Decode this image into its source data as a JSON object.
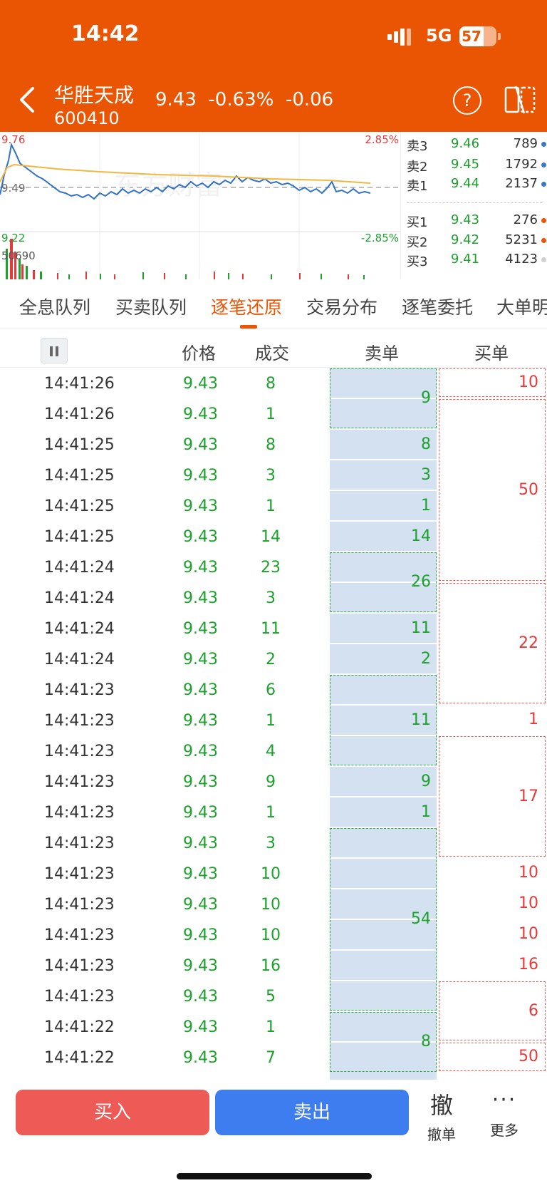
{
  "status_bar": {
    "time": "14:42",
    "network": "5G",
    "battery": "57"
  },
  "header": {
    "stock_name": "华胜天成",
    "stock_code": "600410",
    "price": "9.43",
    "change_pct": "-0.63%",
    "change": "-0.06",
    "help_label": "?"
  },
  "chart": {
    "high_price": "9.76",
    "pre_close": "9.49",
    "low_price": "9.22",
    "high_pct": "2.85%",
    "low_pct": "-2.85%",
    "volume_max": "50690",
    "watermark": "东方财富"
  },
  "orderbook": {
    "asks": [
      {
        "label": "卖3",
        "price": "9.46",
        "qty": "789"
      },
      {
        "label": "卖2",
        "price": "9.45",
        "qty": "1792"
      },
      {
        "label": "卖1",
        "price": "9.44",
        "qty": "2137"
      }
    ],
    "bids": [
      {
        "label": "买1",
        "price": "9.43",
        "qty": "276"
      },
      {
        "label": "买2",
        "price": "9.42",
        "qty": "5231"
      },
      {
        "label": "买3",
        "price": "9.41",
        "qty": "4123"
      }
    ]
  },
  "tabs": [
    {
      "label": "全息队列"
    },
    {
      "label": "买卖队列"
    },
    {
      "label": "逐笔还原"
    },
    {
      "label": "交易分布"
    },
    {
      "label": "逐笔委托"
    },
    {
      "label": "大单明"
    }
  ],
  "columns": {
    "price": "价格",
    "volume": "成交",
    "sell": "卖单",
    "buy": "买单"
  },
  "rows": [
    {
      "time": "14:41:26",
      "price": "9.43",
      "vol": "8"
    },
    {
      "time": "14:41:26",
      "price": "9.43",
      "vol": "1"
    },
    {
      "time": "14:41:25",
      "price": "9.43",
      "vol": "8"
    },
    {
      "time": "14:41:25",
      "price": "9.43",
      "vol": "3"
    },
    {
      "time": "14:41:25",
      "price": "9.43",
      "vol": "1"
    },
    {
      "time": "14:41:25",
      "price": "9.43",
      "vol": "14"
    },
    {
      "time": "14:41:24",
      "price": "9.43",
      "vol": "23"
    },
    {
      "time": "14:41:24",
      "price": "9.43",
      "vol": "3"
    },
    {
      "time": "14:41:24",
      "price": "9.43",
      "vol": "11"
    },
    {
      "time": "14:41:24",
      "price": "9.43",
      "vol": "2"
    },
    {
      "time": "14:41:23",
      "price": "9.43",
      "vol": "6"
    },
    {
      "time": "14:41:23",
      "price": "9.43",
      "vol": "1"
    },
    {
      "time": "14:41:23",
      "price": "9.43",
      "vol": "4"
    },
    {
      "time": "14:41:23",
      "price": "9.43",
      "vol": "9"
    },
    {
      "time": "14:41:23",
      "price": "9.43",
      "vol": "1"
    },
    {
      "time": "14:41:23",
      "price": "9.43",
      "vol": "3"
    },
    {
      "time": "14:41:23",
      "price": "9.43",
      "vol": "10"
    },
    {
      "time": "14:41:23",
      "price": "9.43",
      "vol": "10"
    },
    {
      "time": "14:41:23",
      "price": "9.43",
      "vol": "10"
    },
    {
      "time": "14:41:23",
      "price": "9.43",
      "vol": "16"
    },
    {
      "time": "14:41:23",
      "price": "9.43",
      "vol": "5"
    },
    {
      "time": "14:41:22",
      "price": "9.43",
      "vol": "1"
    },
    {
      "time": "14:41:22",
      "price": "9.43",
      "vol": "7"
    }
  ],
  "sell_orders": [
    {
      "value": "9"
    },
    {
      "value": "8"
    },
    {
      "value": "3"
    },
    {
      "value": "1"
    },
    {
      "value": "14"
    },
    {
      "value": "26"
    },
    {
      "value": "11"
    },
    {
      "value": "2"
    },
    {
      "value": "11"
    },
    {
      "value": "9"
    },
    {
      "value": "1"
    },
    {
      "value": "54"
    },
    {
      "value": "8"
    }
  ],
  "buy_orders": [
    {
      "value": "10"
    },
    {
      "value": "50"
    },
    {
      "value": "22"
    },
    {
      "value": "1"
    },
    {
      "value": "17"
    },
    {
      "value": "10"
    },
    {
      "value": "10"
    },
    {
      "value": "10"
    },
    {
      "value": "16"
    },
    {
      "value": "6"
    },
    {
      "value": "50"
    }
  ],
  "actions": {
    "buy": "买入",
    "sell": "卖出",
    "cancel_glyph": "撤",
    "cancel": "撤单",
    "more_glyph": "···",
    "more": "更多"
  },
  "colors": {
    "brand": "#EA5503",
    "green": "#1BA12C",
    "red": "#E33B3B",
    "sell_bg": "#D4E1F0"
  }
}
